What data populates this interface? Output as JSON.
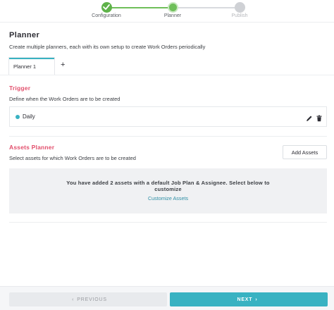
{
  "stepper": {
    "steps": [
      {
        "label": "Configuration",
        "status": "complete"
      },
      {
        "label": "Planner",
        "status": "current"
      },
      {
        "label": "Publish",
        "status": "pending"
      }
    ]
  },
  "header": {
    "title": "Planner",
    "description": "Create multiple planners, each with its own setup to create Work Orders periodically"
  },
  "tabs": {
    "items": [
      {
        "label": "Planner 1",
        "active": true
      }
    ],
    "add_label": "+"
  },
  "trigger": {
    "title": "Trigger",
    "description": "Define when the Work Orders are to be created",
    "item_label": "Daily",
    "icons": [
      "pencil-icon",
      "trash-icon"
    ]
  },
  "assets": {
    "title": "Assets Planner",
    "description": "Select assets for which Work Orders are to be created",
    "add_button": "Add Assets",
    "info_message": "You have added 2 assets with a default Job Plan & Assignee. Select below to customize",
    "customize_link": "Customize Assets"
  },
  "footer": {
    "previous_label": "PREVIOUS",
    "next_label": "NEXT"
  },
  "colors": {
    "accent": "#39b2c2",
    "section_title": "#e24f6c",
    "step_complete": "#5fb24a",
    "link": "#2f8fa6"
  }
}
